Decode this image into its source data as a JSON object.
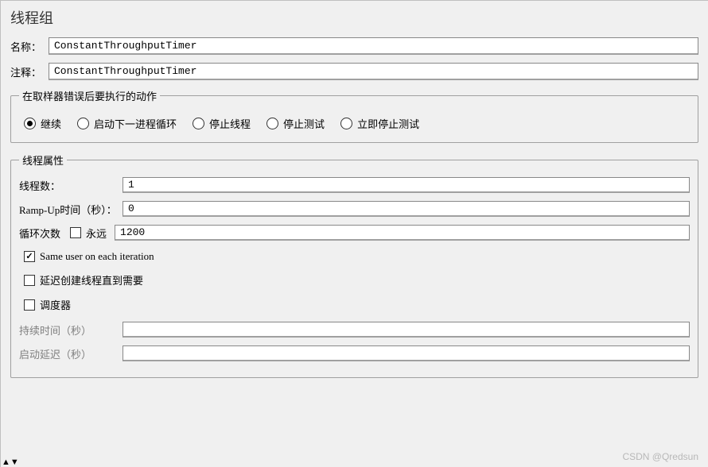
{
  "title": "线程组",
  "labels": {
    "name": "名称：",
    "comment": "注释："
  },
  "fields": {
    "name": "ConstantThroughputTimer",
    "comment": "ConstantThroughputTimer"
  },
  "errorAction": {
    "legend": "在取样器错误后要执行的动作",
    "options": {
      "continue": "继续",
      "startNext": "启动下一进程循环",
      "stopThread": "停止线程",
      "stopTest": "停止测试",
      "stopTestNow": "立即停止测试"
    },
    "selected": "continue"
  },
  "threadProps": {
    "legend": "线程属性",
    "labels": {
      "numThreads": "线程数：",
      "rampUp": "Ramp-Up时间（秒）：",
      "loopCount": "循环次数",
      "forever": "永远",
      "sameUser": "Same user on each iteration",
      "delayedStart": "延迟创建线程直到需要",
      "scheduler": "调度器",
      "duration": "持续时间（秒）",
      "startupDelay": "启动延迟（秒）"
    },
    "values": {
      "numThreads": "1",
      "rampUp": "0",
      "loopCount": "1200",
      "duration": "",
      "startupDelay": ""
    },
    "checks": {
      "forever": false,
      "sameUser": true,
      "delayedStart": false,
      "scheduler": false
    }
  },
  "watermark": "CSDN @Qredsun"
}
